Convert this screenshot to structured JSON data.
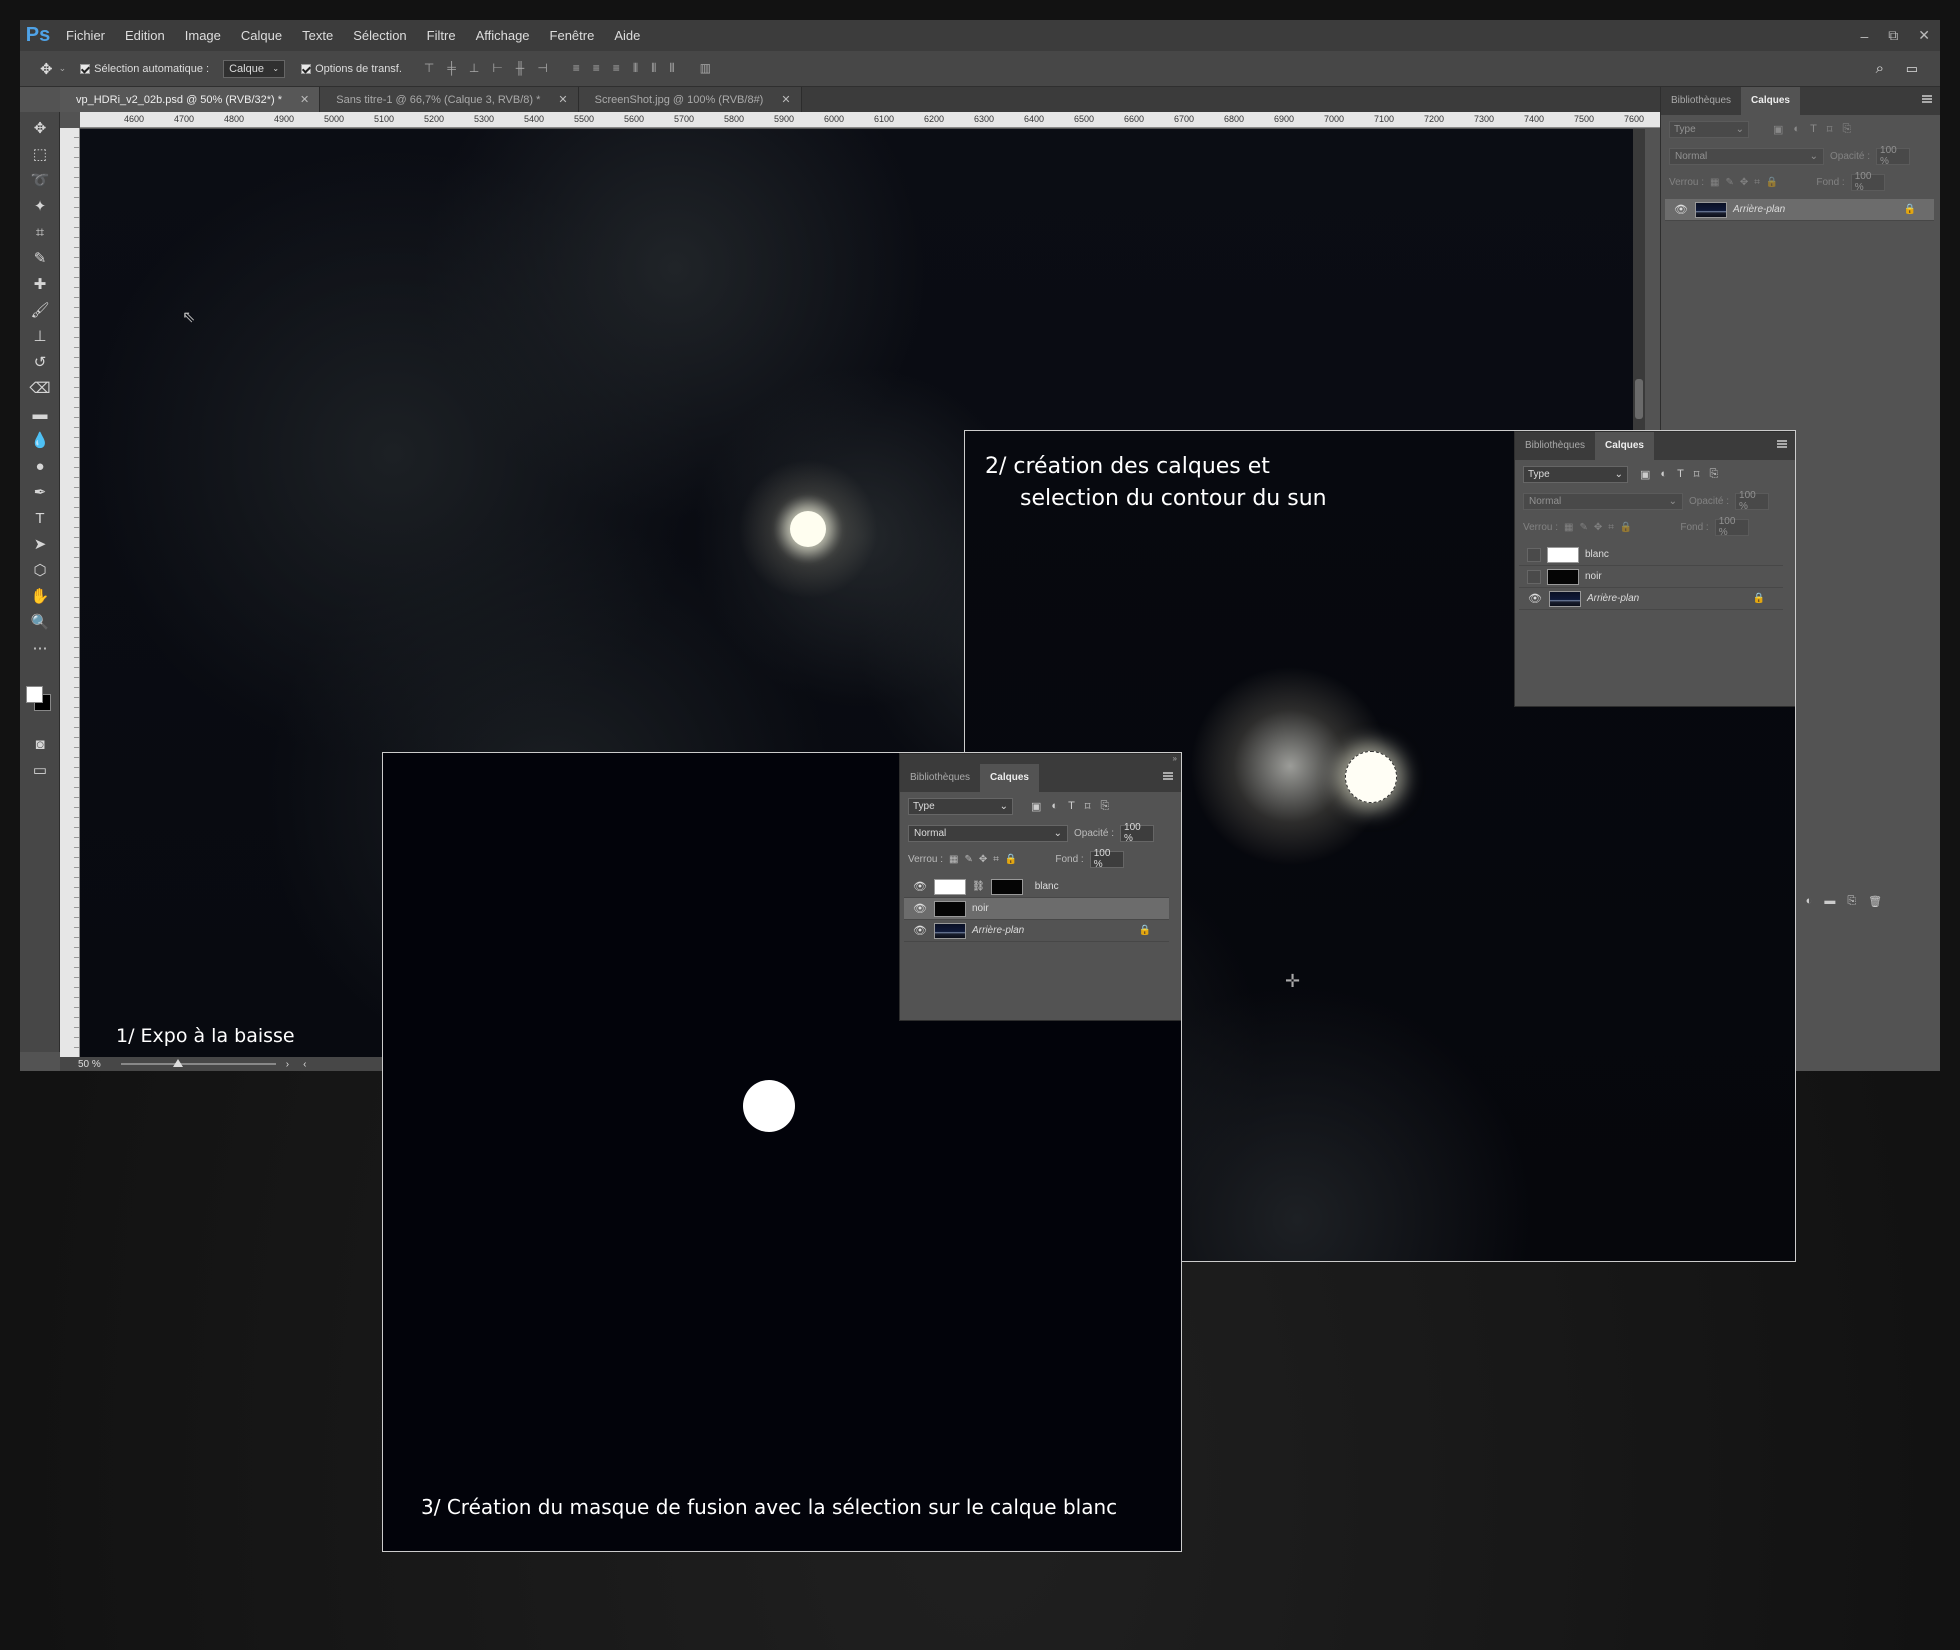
{
  "app": {
    "logo": "Ps",
    "menu": [
      "Fichier",
      "Edition",
      "Image",
      "Calque",
      "Texte",
      "Sélection",
      "Filtre",
      "Affichage",
      "Fenêtre",
      "Aide"
    ],
    "window_controls": [
      "–",
      "⧉",
      "✕"
    ]
  },
  "options_bar": {
    "auto_select_label": "Sélection automatique :",
    "auto_select_value": "Calque",
    "transform_label": "Options de transf."
  },
  "tabs": [
    {
      "label": "vp_HDRi_v2_02b.psd @ 50% (RVB/32*) *",
      "active": true
    },
    {
      "label": "Sans titre-1 @ 66,7% (Calque 3, RVB/8) *",
      "active": false
    },
    {
      "label": "ScreenShot.jpg @ 100% (RVB/8#)",
      "active": false
    }
  ],
  "ruler": {
    "top": [
      "4600",
      "4700",
      "4800",
      "4900",
      "5000",
      "5100",
      "5200",
      "5300",
      "5400",
      "5500",
      "5600",
      "5700",
      "5800",
      "5900",
      "6000",
      "6100",
      "6200",
      "6300",
      "6400",
      "6500",
      "6600",
      "6700",
      "6800",
      "6900",
      "7000",
      "7100",
      "7200",
      "7300",
      "7400",
      "7500",
      "7600"
    ]
  },
  "status": {
    "zoom": "50 %"
  },
  "panels": {
    "tab_libraries": "Bibliothèques",
    "tab_layers": "Calques",
    "filter_type": "Type",
    "blend_mode": "Normal",
    "opacity_label": "Opacité :",
    "opacity_value": "100 %",
    "lock_label": "Verrou :",
    "fill_label": "Fond :",
    "fill_value": "100 %"
  },
  "layers_main": [
    {
      "name": "Arrière-plan",
      "visible": true,
      "locked": true,
      "italic": true
    }
  ],
  "layers_step2": [
    {
      "name": "blanc",
      "visible": false
    },
    {
      "name": "noir",
      "visible": false
    },
    {
      "name": "Arrière-plan",
      "visible": true,
      "locked": true
    }
  ],
  "layers_step3": [
    {
      "name": "blanc",
      "visible": true,
      "mask": true
    },
    {
      "name": "noir",
      "visible": true,
      "selected": true
    },
    {
      "name": "Arrière-plan",
      "visible": true,
      "locked": true
    }
  ],
  "captions": {
    "step1": "1/  Expo à la baisse",
    "step2_line1": "2/  création des calques et",
    "step2_line2": "selection du contour  du sun",
    "step3": "3/  Création du masque de fusion avec la sélection sur le calque blanc"
  },
  "colors": {
    "accent": "#4fa3e8",
    "panel": "#535353",
    "canvas": "#080a10"
  }
}
